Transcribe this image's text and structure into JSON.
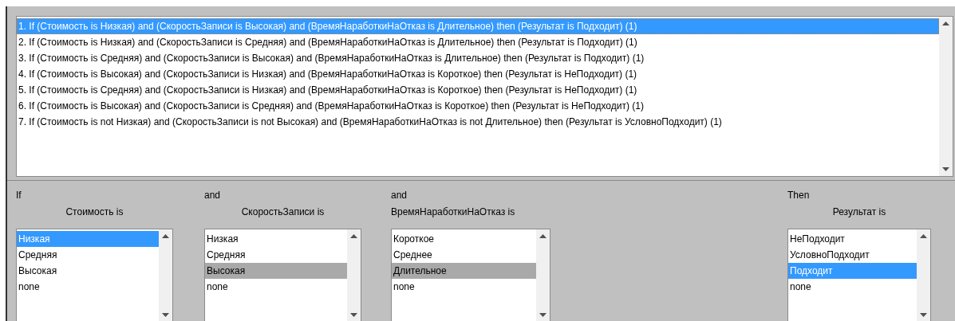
{
  "rules": [
    {
      "text": "1. If (Стоимость is Низкая) and (СкоростьЗаписи is Высокая) and (ВремяНаработкиНаОтказ is Длительное) then (Результат is Подходит) (1)",
      "selected": true
    },
    {
      "text": "2. If (Стоимость is Низкая) and (СкоростьЗаписи is Средняя) and (ВремяНаработкиНаОтказ is Длительное) then (Результат is Подходит) (1)",
      "selected": false
    },
    {
      "text": "3. If (Стоимость is Средняя) and (СкоростьЗаписи is Высокая) and (ВремяНаработкиНаОтказ is Длительное) then (Результат is Подходит) (1)",
      "selected": false
    },
    {
      "text": "4. If (Стоимость is Высокая) and (СкоростьЗаписи is Низкая) and (ВремяНаработкиНаОтказ is Короткое) then (Результат is НеПодходит) (1)",
      "selected": false
    },
    {
      "text": "5. If (Стоимость is Средняя) and (СкоростьЗаписи is Низкая) and (ВремяНаработкиНаОтказ is Короткое) then (Результат is НеПодходит) (1)",
      "selected": false
    },
    {
      "text": "6. If (Стоимость is Высокая) and (СкоростьЗаписи is Средняя) and (ВремяНаработкиНаОтказ is Короткое) then (Результат is НеПодходит) (1)",
      "selected": false
    },
    {
      "text": "7. If (Стоимость is not Низкая) and (СкоростьЗаписи is not Высокая) and (ВремяНаработкиНаОтказ is not Длительное) then (Результат is УсловноПодходит) (1)",
      "selected": false
    }
  ],
  "inputs": [
    {
      "connective": "If",
      "label": "Стоимость is",
      "focused": true,
      "options": [
        {
          "text": "Низкая",
          "selected": true
        },
        {
          "text": "Средняя",
          "selected": false
        },
        {
          "text": "Высокая",
          "selected": false
        },
        {
          "text": "none",
          "selected": false
        }
      ]
    },
    {
      "connective": "and",
      "label": "СкоростьЗаписи is",
      "focused": false,
      "options": [
        {
          "text": "Низкая",
          "selected": false
        },
        {
          "text": "Средняя",
          "selected": false
        },
        {
          "text": "Высокая",
          "selected": true
        },
        {
          "text": "none",
          "selected": false
        }
      ]
    },
    {
      "connective": "and",
      "label": "ВремяНаработкиНаОтказ is",
      "focused": false,
      "options": [
        {
          "text": "Короткое",
          "selected": false
        },
        {
          "text": "Среднее",
          "selected": false
        },
        {
          "text": "Длительное",
          "selected": true
        },
        {
          "text": "none",
          "selected": false
        }
      ]
    }
  ],
  "output": {
    "connective": "Then",
    "label": "Результат is",
    "focused": true,
    "options": [
      {
        "text": "НеПодходит",
        "selected": false
      },
      {
        "text": "УсловноПодходит",
        "selected": false
      },
      {
        "text": "Подходит",
        "selected": true
      },
      {
        "text": "none",
        "selected": false
      }
    ]
  }
}
